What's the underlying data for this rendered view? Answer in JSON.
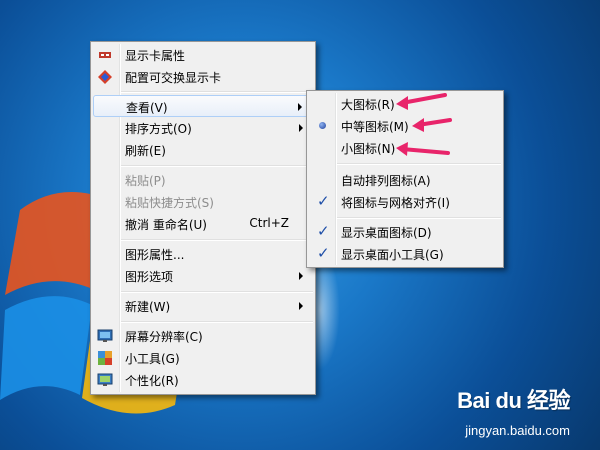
{
  "context_menu": {
    "items": [
      {
        "label": "显示卡属性",
        "icon": "display-card-icon"
      },
      {
        "label": "配置可交换显示卡",
        "icon": "switchable-graphics-icon"
      },
      {
        "label": "查看(V)",
        "submenu": true
      },
      {
        "label": "排序方式(O)",
        "submenu": true
      },
      {
        "label": "刷新(E)"
      },
      {
        "label": "粘贴(P)",
        "disabled": true
      },
      {
        "label": "粘贴快捷方式(S)",
        "disabled": true
      },
      {
        "label": "撤消 重命名(U)",
        "shortcut": "Ctrl+Z"
      },
      {
        "label": "图形属性..."
      },
      {
        "label": "图形选项",
        "submenu": true
      },
      {
        "label": "新建(W)",
        "submenu": true
      },
      {
        "label": "屏幕分辨率(C)",
        "icon": "screen-resolution-icon"
      },
      {
        "label": "小工具(G)",
        "icon": "gadgets-icon"
      },
      {
        "label": "个性化(R)",
        "icon": "personalize-icon"
      }
    ]
  },
  "view_submenu": {
    "items": [
      {
        "label": "大图标(R)"
      },
      {
        "label": "中等图标(M)",
        "selected": true
      },
      {
        "label": "小图标(N)"
      },
      {
        "label": "自动排列图标(A)"
      },
      {
        "label": "将图标与网格对齐(I)",
        "checked": true
      },
      {
        "label": "显示桌面图标(D)",
        "checked": true
      },
      {
        "label": "显示桌面小工具(G)",
        "checked": true
      }
    ]
  },
  "watermark": {
    "brand": "Bai du 经验",
    "site": "jingyan.baidu.com"
  },
  "colors": {
    "annotation_arrow": "#e8246a",
    "highlight_border": "#aecff7",
    "desktop": "#1a78c8"
  }
}
